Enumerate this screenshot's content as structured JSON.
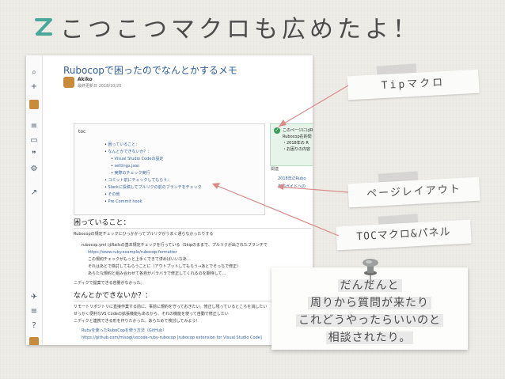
{
  "slide": {
    "title": "こつこつマクロも広めたよ！",
    "accent_color": "#4aa89a",
    "text_color": "#4b4b4b",
    "arrow_color": "#d98a8a"
  },
  "screenshot": {
    "page_title": "Rubocopで困ったのでなんとかするメモ",
    "author": "Akiko",
    "updated": "最終更新日 2018/10/20",
    "toc": {
      "heading": "toc",
      "items": [
        {
          "label": "困っていること：",
          "level": 2
        },
        {
          "label": "なんとかできないか？：",
          "level": 2
        },
        {
          "label": "Visual Studio Codeの設定",
          "level": 3
        },
        {
          "label": "settings.json",
          "level": 3
        },
        {
          "label": "実際のチェック実行",
          "level": 3
        },
        {
          "label": "コミット前にチェックしてもらう：",
          "level": 2
        },
        {
          "label": "Slackに投稿してプルリクの前のブランチをチェック",
          "level": 2
        },
        {
          "label": "その他",
          "level": 2
        },
        {
          "label": "Pre Commit hook",
          "level": 2
        }
      ]
    },
    "info": {
      "lines": [
        "このページにはR",
        "Rubocop在的問",
        "・2018年の R",
        "・お困りの内容"
      ]
    },
    "related": {
      "heading": "関連",
      "items": [
        "2018年のRubo",
        "資料ガイドへの"
      ]
    },
    "section1": {
      "heading": "困っていること：",
      "intro": "Rubocopの規定チェックにひっかかってプルリクがうまく通らなかったりする",
      "bullets": [
        "rubocop.yml はRailsの基本規定チェックを行っている（Skipのままで、プルリクが出されたブランチで",
        "https://www.ruby.example/rubocop-formatter",
        "この規約チェックがもっと上手くできて済めばいいなあ…",
        "それはあとで検討してもらうことに（アウトプットしてもらう→あとでそっちで修正）",
        "あらたな規約と組み合わせて各自がバラバラで修正してくれるのを期待して…"
      ],
      "note": "ニディクで提案できる容量がなかった。"
    },
    "section2": {
      "heading": "なんとかできないか？：",
      "lines": [
        "リモートリポジトリに直接作業する前に、事前に規約を守っておきたい。修正し残っているところを消したい",
        "せっかく便利なVS Codeの拡張機能もあるから、それの機能を使って自動で修正したい",
        "ニディクと連携できる形を作りたかった。あらためて検討してみよう！"
      ],
      "links": [
        "Rubyを使ったRuboCopを使う方法（GitHub）",
        "https://github.com/misogi/vscode-ruby-rubocop [rubocop extension for Visual Studio Code]"
      ]
    }
  },
  "labels": {
    "tip": "Tipマクロ",
    "page_layout": "ページレイアウト",
    "toc_panel": "TOCマクロ&パネル"
  },
  "note": {
    "lines": [
      "だんだんと",
      "周りから質問が来たり",
      "これどうやったらいいのと",
      "相談されたり。"
    ]
  }
}
